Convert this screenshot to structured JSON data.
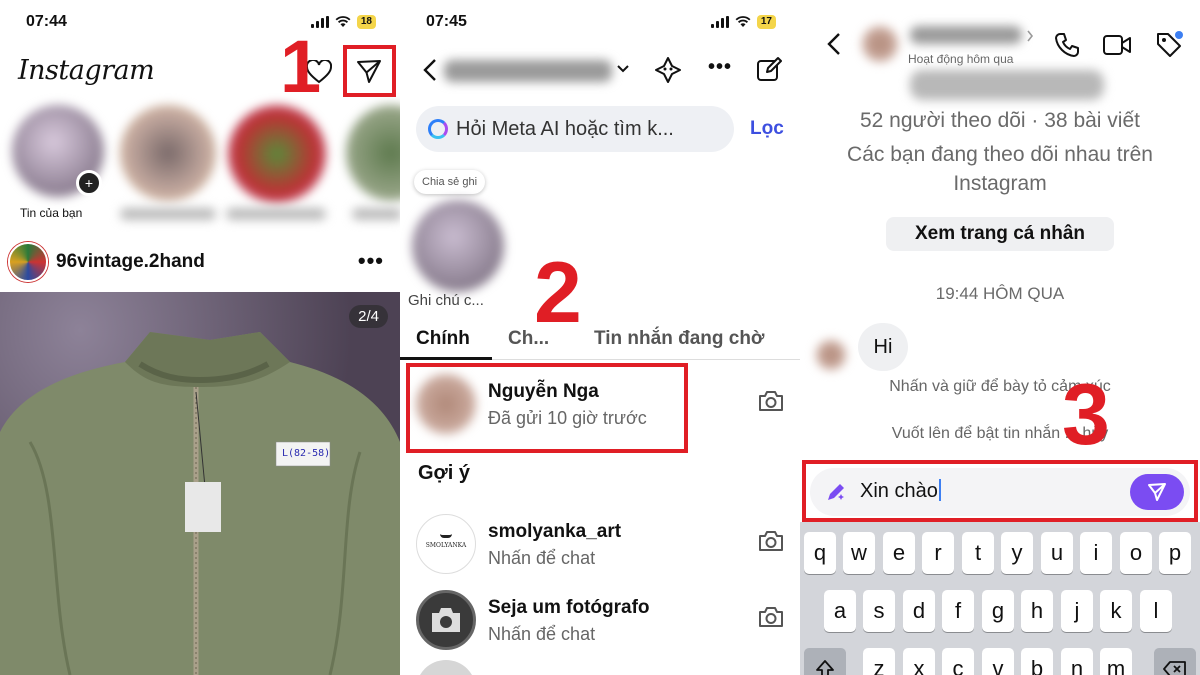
{
  "colors": {
    "highlight_red": "#e01e25",
    "meta_blue": "#3d4fe0",
    "send_purple": "#7b4cf2",
    "keyboard_bg": "#d3d5da"
  },
  "step_numbers": [
    "1",
    "2",
    "3"
  ],
  "panel_feed": {
    "status": {
      "time": "07:44",
      "battery": "18"
    },
    "app_title": "Instagram",
    "header_icons": [
      "heart-icon",
      "paper-plane-icon"
    ],
    "stories": [
      {
        "label": "Tin của bạn"
      }
    ],
    "post": {
      "username": "96vintage.2hand",
      "more": "•••",
      "counter": "2/4",
      "tag_text": "L(82-58)"
    }
  },
  "panel_inbox": {
    "status": {
      "time": "07:45",
      "battery": "17"
    },
    "search": {
      "placeholder": "Hỏi Meta AI hoặc tìm k...",
      "filter_label": "Lọc"
    },
    "note": {
      "bubble": "Chia sẻ ghi",
      "caption": "Ghi chú c..."
    },
    "tabs": [
      {
        "label": "Chính"
      },
      {
        "label": "Ch..."
      },
      {
        "label": "Tin nhắn đang chờ"
      }
    ],
    "conversation": {
      "name": "Nguyễn Nga",
      "status": "Đã gửi 10 giờ trước"
    },
    "suggestions_title": "Gợi ý",
    "suggestions": [
      {
        "name": "smolyanka_art",
        "subtitle": "Nhấn để chat",
        "logo_text": "SMOLYANKA"
      },
      {
        "name": "Seja um fotógrafo",
        "subtitle": "Nhấn để chat"
      }
    ]
  },
  "panel_chat": {
    "header_status": "Hoạt động hôm qua",
    "profile_stats": "52 người theo dõi · 38 bài viết",
    "mutual_follow": "Các bạn đang theo dõi nhau trên Instagram",
    "view_profile_label": "Xem trang cá nhân",
    "timestamp": "19:44 HÔM QUA",
    "message": "Hi",
    "hint_react": "Nhấn và giữ để bày tỏ cảm xúc",
    "hint_vanish": "Vuốt lên để bật tin nhắn ... hủy",
    "input_value": "Xin chào",
    "keyboard_rows": [
      [
        "q",
        "w",
        "e",
        "r",
        "t",
        "y",
        "u",
        "i",
        "o",
        "p"
      ],
      [
        "a",
        "s",
        "d",
        "f",
        "g",
        "h",
        "j",
        "k",
        "l"
      ],
      [
        "z",
        "x",
        "c",
        "v",
        "b",
        "n",
        "m"
      ]
    ]
  }
}
